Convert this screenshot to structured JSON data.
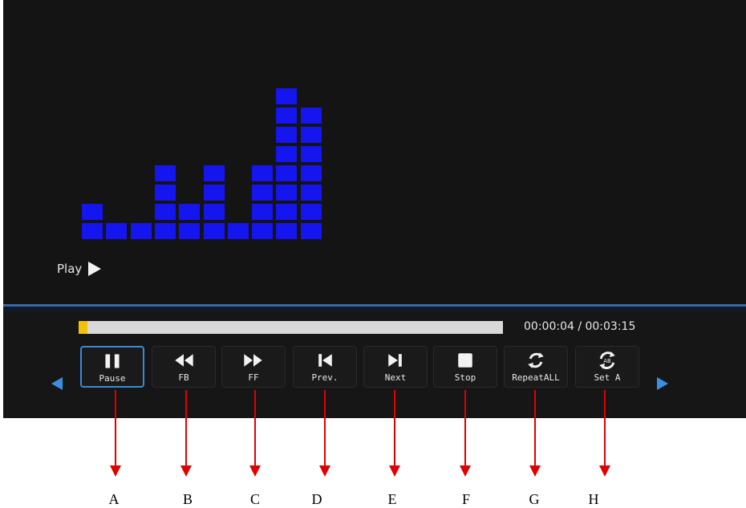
{
  "player": {
    "status_label": "Play",
    "time": "00:00:04 / 00:03:15",
    "progress": 0.02,
    "progress_color": "#f0c20a",
    "accent_color": "#3a8ad6",
    "equalizer_color": "#1515f0",
    "equalizer_levels": [
      2,
      1,
      1,
      4,
      2,
      4,
      1,
      4,
      8,
      7
    ]
  },
  "controls": [
    {
      "label": "Pause",
      "icon": "pause-icon",
      "selected": true
    },
    {
      "label": "FB",
      "icon": "fast-backward-icon"
    },
    {
      "label": "FF",
      "icon": "fast-forward-icon"
    },
    {
      "label": "Prev.",
      "icon": "previous-icon"
    },
    {
      "label": "Next",
      "icon": "next-icon"
    },
    {
      "label": "Stop",
      "icon": "stop-icon"
    },
    {
      "label": "RepeatALL",
      "icon": "repeat-icon"
    },
    {
      "label": "Set A",
      "icon": "set-ab-icon"
    }
  ],
  "callout_letters": [
    "A",
    "B",
    "C",
    "D",
    "E",
    "F",
    "G",
    "H"
  ]
}
